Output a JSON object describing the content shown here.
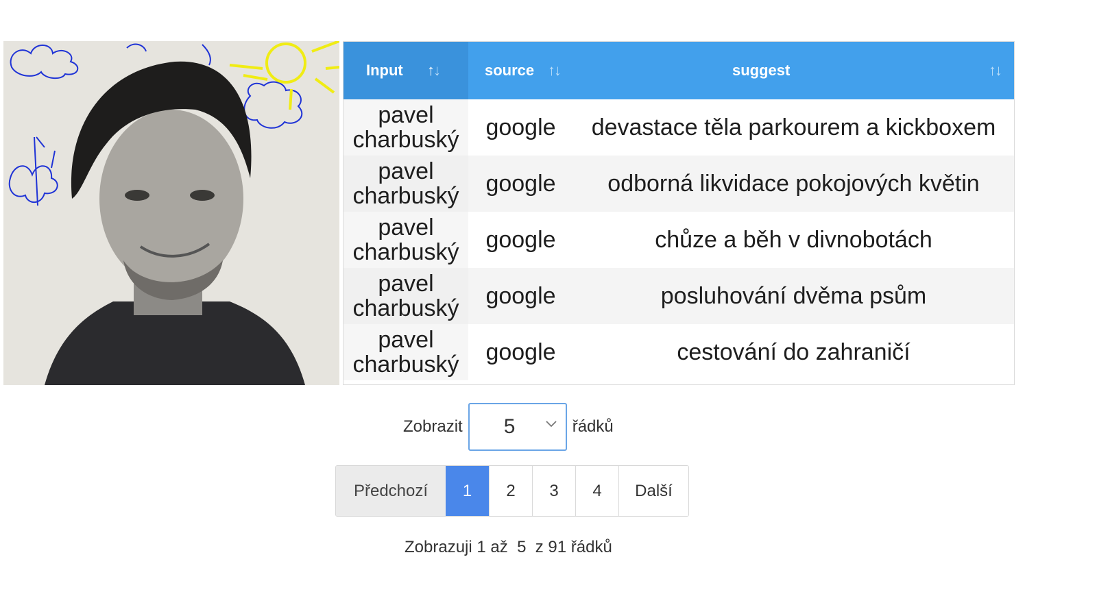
{
  "table": {
    "headers": [
      {
        "label": "Input"
      },
      {
        "label": "source"
      },
      {
        "label": "suggest"
      }
    ],
    "rows": [
      {
        "input": "pavel charbuský",
        "source": "google",
        "suggest": "devastace těla parkourem a kickboxem"
      },
      {
        "input": "pavel charbuský",
        "source": "google",
        "suggest": "odborná likvidace pokojových květin"
      },
      {
        "input": "pavel charbuský",
        "source": "google",
        "suggest": "chůze a běh v divnobotách"
      },
      {
        "input": "pavel charbuský",
        "source": "google",
        "suggest": "posluhování dvěma psům"
      },
      {
        "input": "pavel charbuský",
        "source": "google",
        "suggest": "cestování do zahraničí"
      }
    ]
  },
  "rows_control": {
    "prefix": "Zobrazit",
    "selected": "5",
    "suffix": "řádků"
  },
  "pagination": {
    "prev": "Předchozí",
    "pages": [
      "1",
      "2",
      "3",
      "4"
    ],
    "active_page": "1",
    "next": "Další"
  },
  "info": {
    "text": "Zobrazuji 1 až  5  z 91 řádků"
  },
  "colors": {
    "header": "#42a0ec",
    "active_page": "#4a87ea",
    "doodle_blue": "#1f33d6",
    "doodle_yellow": "#f0ec14"
  }
}
